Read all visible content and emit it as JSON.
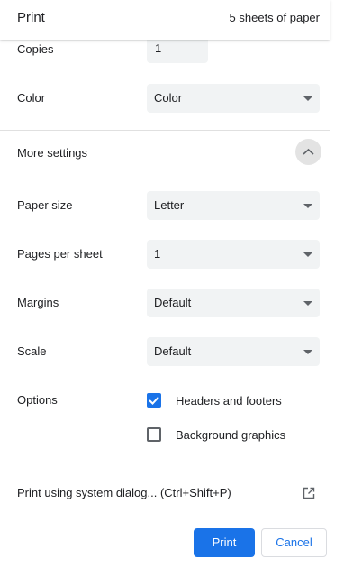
{
  "header": {
    "title": "Print",
    "sheets": "5 sheets of paper"
  },
  "settings": {
    "copies": {
      "label": "Copies",
      "value": "1"
    },
    "color": {
      "label": "Color",
      "value": "Color"
    },
    "more_settings": {
      "label": "More settings",
      "expanded": true
    },
    "paper_size": {
      "label": "Paper size",
      "value": "Letter"
    },
    "pages_per_sheet": {
      "label": "Pages per sheet",
      "value": "1"
    },
    "margins": {
      "label": "Margins",
      "value": "Default"
    },
    "scale": {
      "label": "Scale",
      "value": "Default"
    },
    "options": {
      "label": "Options",
      "headers_footers": {
        "label": "Headers and footers",
        "checked": true
      },
      "background_graphics": {
        "label": "Background graphics",
        "checked": false
      }
    }
  },
  "system_dialog": {
    "label": "Print using system dialog... (Ctrl+Shift+P)",
    "icon": "open-in-new-icon"
  },
  "footer": {
    "print_label": "Print",
    "cancel_label": "Cancel"
  },
  "colors": {
    "accent": "#1a73e8",
    "field_bg": "#f1f3f4",
    "text": "#202124"
  }
}
